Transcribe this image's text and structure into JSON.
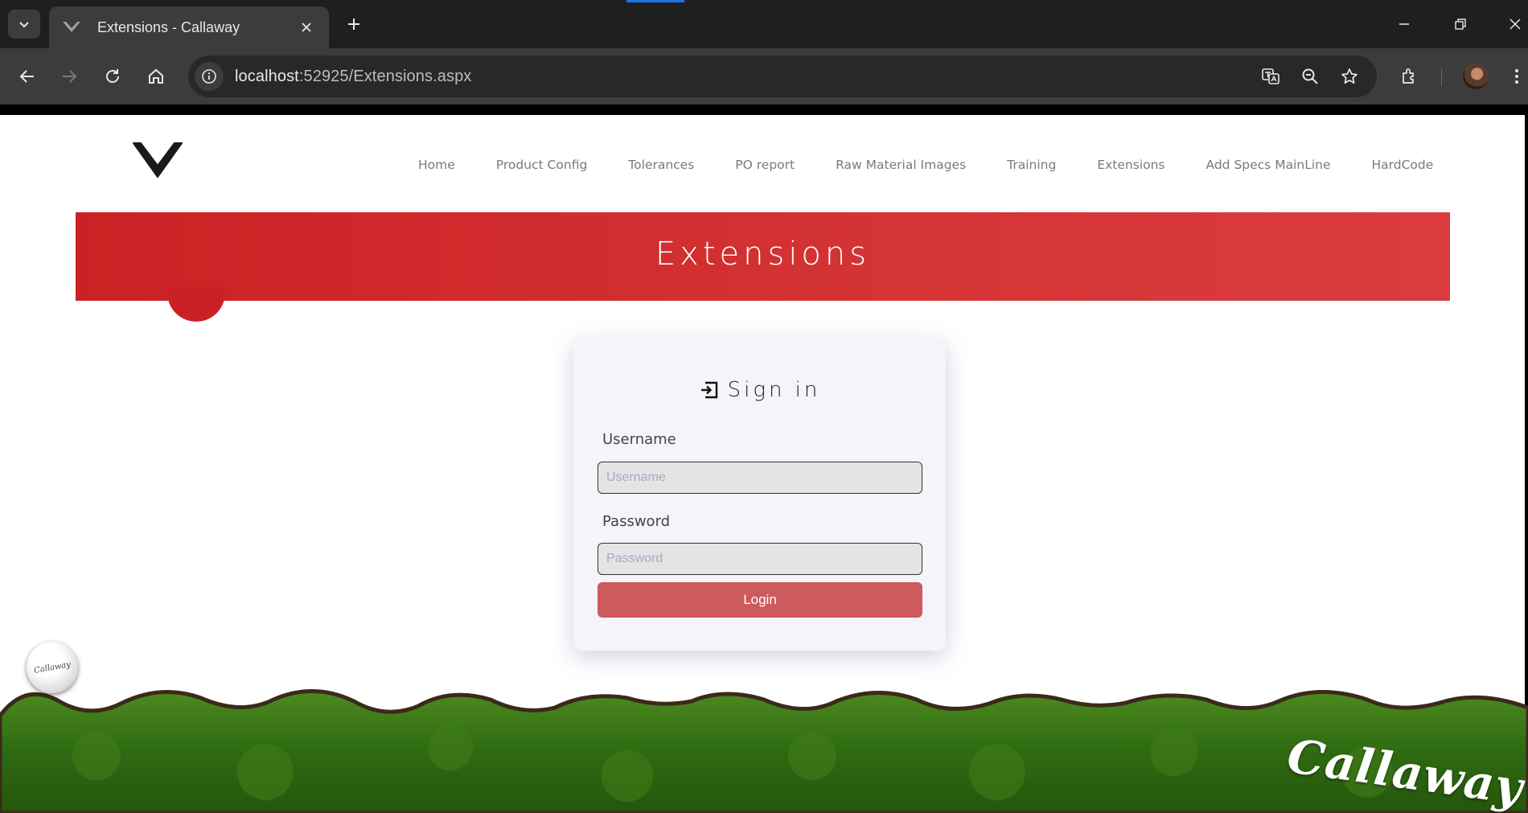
{
  "browser": {
    "tab_title": "Extensions - Callaway",
    "url_host": "localhost",
    "url_path": ":52925/Extensions.aspx"
  },
  "nav": {
    "items": [
      "Home",
      "Product Config",
      "Tolerances",
      "PO report",
      "Raw Material Images",
      "Training",
      "Extensions",
      "Add Specs MainLine",
      "HardCode"
    ]
  },
  "banner": {
    "title": "Extensions"
  },
  "signin": {
    "title": "Sign in",
    "username_label": "Username",
    "username_placeholder": "Username",
    "password_label": "Password",
    "password_placeholder": "Password",
    "login_label": "Login"
  },
  "footer": {
    "ball_text": "Callaway",
    "brand_text": "Callaway"
  },
  "colors": {
    "banner": "#cc2124",
    "login_button": "#cd5a5c",
    "chrome_dark": "#1f1f1f"
  }
}
